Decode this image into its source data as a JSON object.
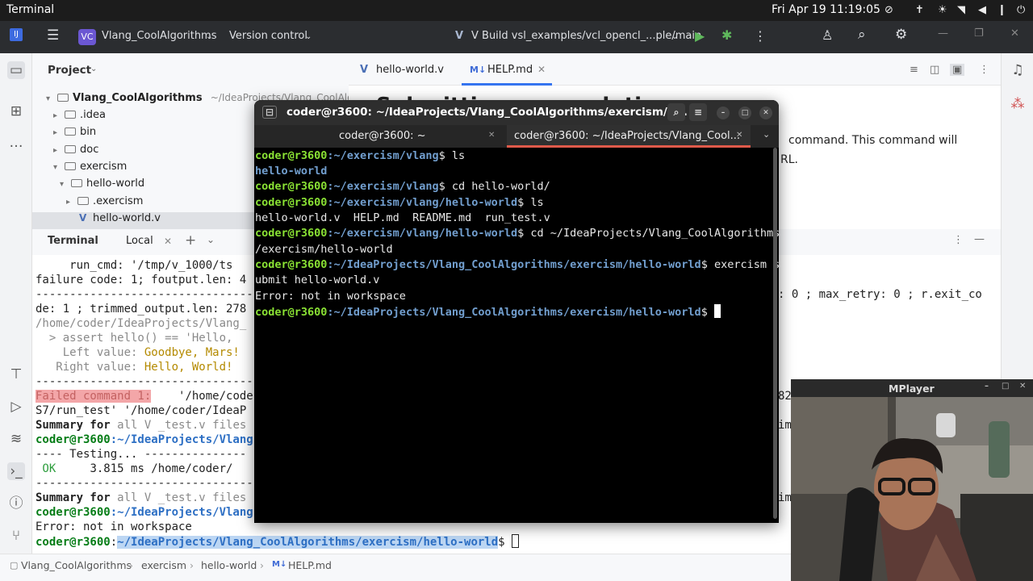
{
  "system_bar": {
    "app_name": "Terminal",
    "clock": "Fri Apr 19  11:19:05"
  },
  "ide_header": {
    "project_badge": "VC",
    "project_name": "Vlang_CoolAlgorithms",
    "version_control": "Version control",
    "run_config": "V Build vsl_examples/vcl_opencl_...ple/main"
  },
  "project_panel": {
    "title": "Project",
    "root": "Vlang_CoolAlgorithms",
    "root_path": "~/IdeaProjects/Vlang_CoolAlgorithms",
    "items": [
      {
        "label": ".idea"
      },
      {
        "label": "bin"
      },
      {
        "label": "doc"
      },
      {
        "label": "exercism"
      },
      {
        "label": "hello-world"
      },
      {
        "label": ".exercism"
      },
      {
        "label": "hello-world.v"
      }
    ]
  },
  "editor": {
    "tabs": [
      {
        "label": "hello-world.v"
      },
      {
        "label": "HELP.md"
      }
    ],
    "visible_text_1": "command. This command will",
    "visible_text_2": "RL.",
    "heading": "Submitting your solution"
  },
  "ij_terminal": {
    "title": "Terminal",
    "tab": "Local",
    "lines": {
      "l1": "     run_cmd: '/tmp/v_1000/ts",
      "l2": "failure code: 1; foutput.len: 4",
      "l3": "--------------------------------",
      "l4": "de: 1 ; trimmed_output.len: 278",
      "l5": "/home/coder/IdeaProjects/Vlang_",
      "l6a": "  > assert ",
      "l6b": "hello() == 'Hello,",
      "l7a": "    Left value: ",
      "l7b": "Goodbye, Mars!",
      "l8a": "   Right value: ",
      "l8b": "Hello, World!",
      "l9": "--------------------------------",
      "l10a": "Failed command 1:",
      "l10b": "    '/home/code",
      "l11": "S7/run_test' '/home/coder/IdeaP",
      "l12a": "Summary for ",
      "l12b": "all V _test.v files",
      "l13a": "coder@r3600",
      "l13b": ":~/IdeaProjects/Vlang",
      "l14": "---- Testing... ---------------",
      "l15a": " OK",
      "l15b": "     3.815 ms /home/coder/",
      "l16": "--------------------------------",
      "l17a": "Summary for ",
      "l17b": "all V _test.v files",
      "l18a": "coder@r3600",
      "l18b": ":~/IdeaProjects/Vlang",
      "l19": "Error: not in workspace",
      "l20a": "coder@r3600",
      "l20b": ":",
      "l20c": "~/IdeaProjects/Vlang_CoolAlgorithms/exercism/hello-world",
      "l20d": "$ ",
      "r1": ": 0 ; max_retry: 0 ; r.exit_co",
      "r2": "82",
      "r3": "im",
      "r4": "im"
    }
  },
  "gnome_terminal": {
    "title": "coder@r3600: ~/IdeaProjects/Vlang_CoolAlgorithms/exercism/h...",
    "tabs": [
      {
        "label": "coder@r3600: ~"
      },
      {
        "label": "coder@r3600: ~/IdeaProjects/Vlang_Cool..."
      }
    ],
    "lines": {
      "a1u": "coder@r3600",
      "a1p": ":~/exercism/vlang",
      "a1c": "$ ls",
      "a2": "hello-world",
      "a3u": "coder@r3600",
      "a3p": ":~/exercism/vlang",
      "a3c": "$ cd hello-world/",
      "a4u": "coder@r3600",
      "a4p": ":~/exercism/vlang/hello-world",
      "a4c": "$ ls",
      "a5": "hello-world.v  HELP.md  README.md  run_test.v",
      "a6u": "coder@r3600",
      "a6p": ":~/exercism/vlang/hello-world",
      "a6c": "$ cd ~/IdeaProjects/Vlang_CoolAlgorithms",
      "a7": "/exercism/hello-world",
      "a8u": "coder@r3600",
      "a8p": ":~/IdeaProjects/Vlang_CoolAlgorithms/exercism/hello-world",
      "a8c": "$ exercism s",
      "a9": "ubmit hello-world.v",
      "a10": "Error: not in workspace",
      "a11u": "coder@r3600",
      "a11p": ":~/IdeaProjects/Vlang_CoolAlgorithms/exercism/hello-world",
      "a11c": "$ "
    }
  },
  "mplayer": {
    "title": "MPlayer"
  },
  "status_bar": {
    "crumbs": [
      {
        "label": "Vlang_CoolAlgorithms"
      },
      {
        "label": "exercism"
      },
      {
        "label": "hello-world"
      },
      {
        "label": "HELP.md"
      }
    ]
  }
}
